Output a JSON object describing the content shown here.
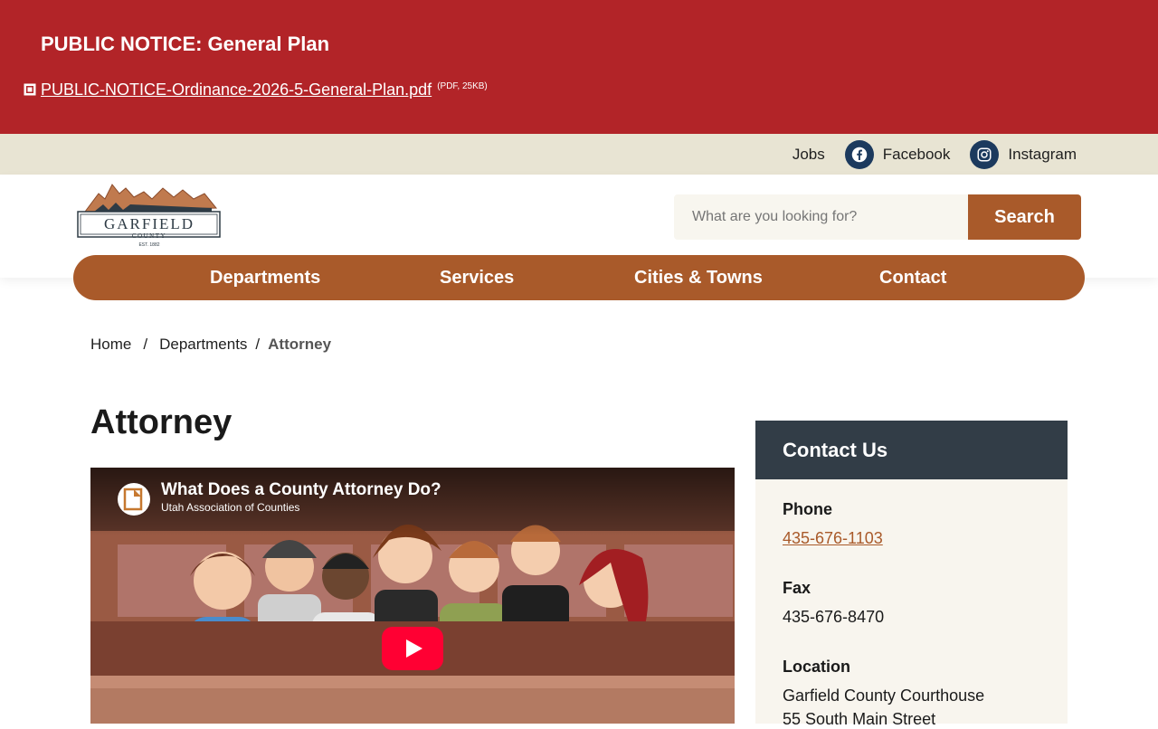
{
  "notice": {
    "title": "PUBLIC NOTICE: General Plan",
    "link_text": "PUBLIC-NOTICE-Ordinance-2026-5-General-Plan.pdf",
    "link_meta": "(PDF, 25KB)"
  },
  "topbar": {
    "jobs": "Jobs",
    "facebook": "Facebook",
    "instagram": "Instagram"
  },
  "logo": {
    "name": "GARFIELD",
    "sub": "COUNTY",
    "est": "EST. 1882"
  },
  "search": {
    "placeholder": "What are you looking for?",
    "button": "Search"
  },
  "nav": {
    "items": [
      "Departments",
      "Services",
      "Cities & Towns",
      "Contact"
    ]
  },
  "breadcrumb": {
    "home": "Home",
    "sep": "/",
    "departments": "Departments",
    "current": "Attorney"
  },
  "page": {
    "title": "Attorney"
  },
  "video": {
    "title": "What Does a County Attorney Do?",
    "channel": "Utah Association of Counties"
  },
  "contact": {
    "heading": "Contact Us",
    "phone_label": "Phone",
    "phone": "435-676-1103",
    "fax_label": "Fax",
    "fax": "435-676-8470",
    "location_label": "Location",
    "location_line1": "Garfield County Courthouse",
    "location_line2": "55 South Main Street"
  },
  "colors": {
    "notice_bg": "#b22428",
    "accent": "#a95a2a",
    "topbar_bg": "#e8e4d3",
    "social_bg": "#1c3a5e",
    "contact_head_bg": "#323d47",
    "contact_bg": "#f8f5ee"
  }
}
